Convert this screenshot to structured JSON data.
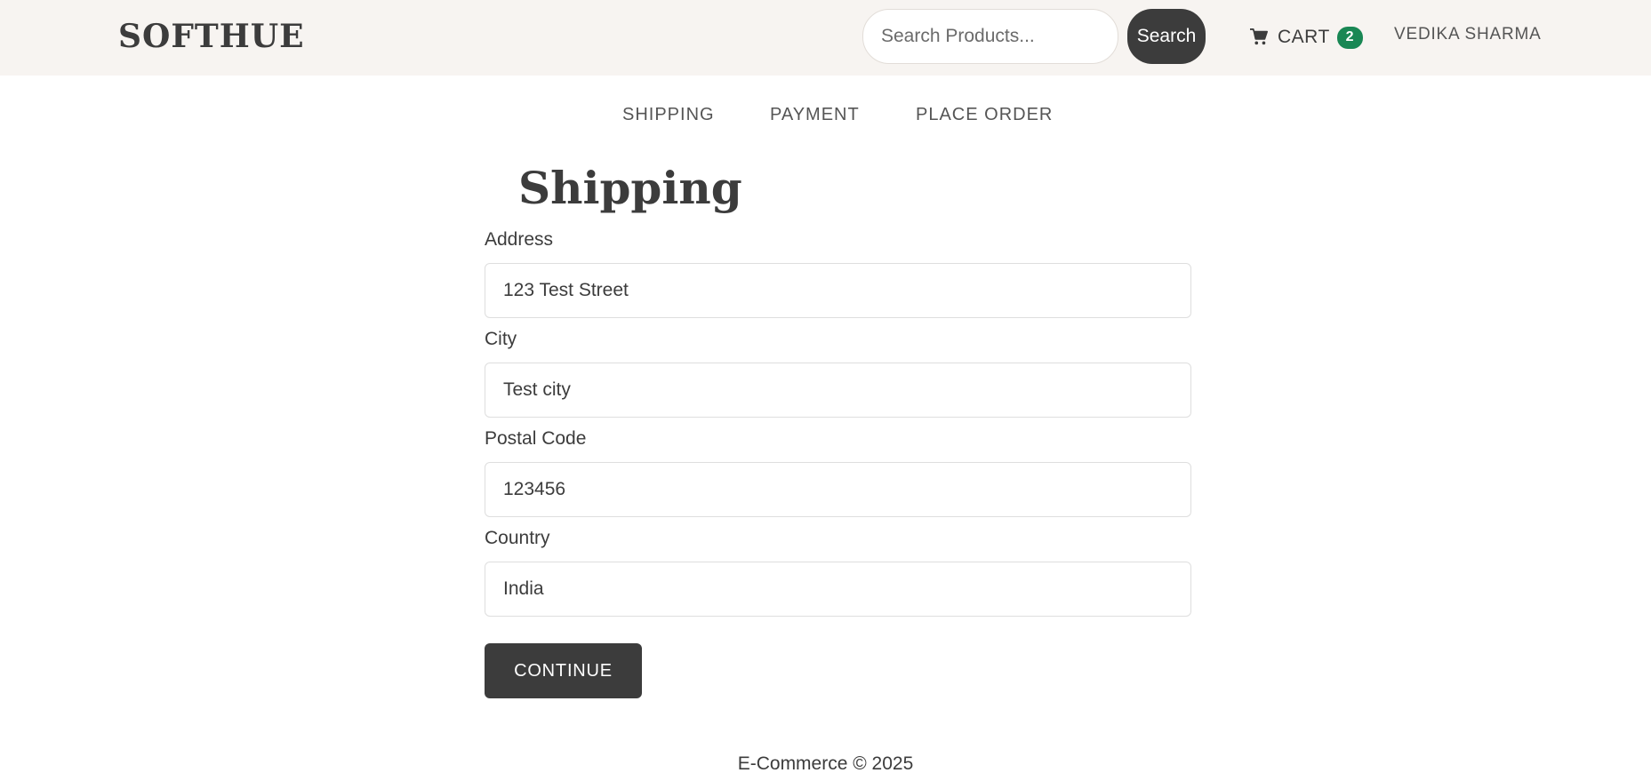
{
  "header": {
    "brand": "SOFTHUE",
    "search_placeholder": "Search Products...",
    "search_value": "",
    "search_button": "Search",
    "cart_label": "CART",
    "cart_count": "2",
    "user_name": "VEDIKA SHARMA",
    "cart_icon": "shopping-cart-icon"
  },
  "steps": {
    "shipping": "SHIPPING",
    "payment": "PAYMENT",
    "place_order": "PLACE ORDER"
  },
  "form": {
    "title": "Shipping",
    "address_label": "Address",
    "address_value": "123 Test Street",
    "city_label": "City",
    "city_value": "Test city",
    "postal_label": "Postal Code",
    "postal_value": "123456",
    "country_label": "Country",
    "country_value": "India",
    "continue_button": "CONTINUE"
  },
  "footer": {
    "text": "E-Commerce © 2025"
  },
  "colors": {
    "navbar_bg": "#f7f4f1",
    "primary_dark": "#3c3c3c",
    "badge_green": "#198754"
  }
}
